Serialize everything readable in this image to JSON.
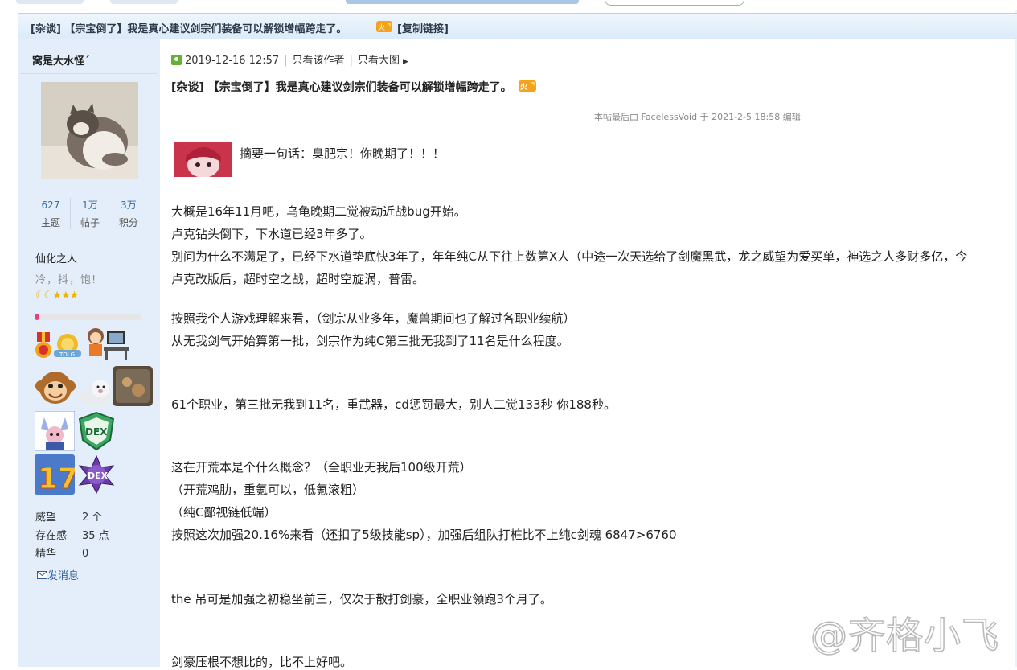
{
  "thread": {
    "title_bar": "[杂谈] 【宗宝倒了】我是真心建议剑宗们装备可以解锁增幅跨走了。",
    "copy_link": "[复制链接]"
  },
  "author": {
    "username": "窝是大水怪´",
    "stats": [
      {
        "num": "627",
        "label": "主题"
      },
      {
        "num": "1万",
        "label": "帖子"
      },
      {
        "num": "3万",
        "label": "积分"
      }
    ],
    "rank": "仙化之人",
    "motto": "冷，抖，饱!",
    "stars": "☾☾★★★",
    "progress_percent": 3,
    "info": [
      {
        "key": "威望",
        "value": "2 个"
      },
      {
        "key": "存在感",
        "value": "35 点"
      },
      {
        "key": "精华",
        "value": "0"
      }
    ],
    "send_message": "发消息"
  },
  "post": {
    "datetime": "2019-12-16 12:57",
    "only_author": "只看该作者",
    "only_big_image": "只看大图",
    "title": "[杂谈] 【宗宝倒了】我是真心建议剑宗们装备可以解锁增幅跨走了。",
    "edited_note": "本帖最后由 FacelessVoid 于 2021-2-5 18:58 编辑",
    "summary": "摘要一句话：臭肥宗！你晚期了！！！",
    "lines": [
      "大概是16年11月吧，乌龟晚期二觉被动近战bug开始。",
      "卢克钻头倒下，下水道已经3年多了。",
      "别问为什么不满足了，已经下水道垫底快3年了，年年纯C从下往上数第X人（中途一次天选给了剑魔黑武，龙之威望为爱买单，神选之人多财多亿，今",
      "卢克改版后，超时空之战，超时空旋涡，普雷。",
      "按照我个人游戏理解来看，（剑宗从业多年，魔兽期间也了解过各职业续航）",
      "从无我剑气开始算第一批，剑宗作为纯C第三批无我到了11名是什么程度。",
      "61个职业，第三批无我到11名，重武器，cd惩罚最大，别人二觉133秒 你188秒。",
      "这在开荒本是个什么概念？（全职业无我后100级开荒）",
      "（开荒鸡肋，重氪可以，低氪滚粗）",
      "（纯C鄙视链低端）",
      "按照这次加强20.16%来看（还扣了5级技能sp），加强后组队打桩比不上纯c剑魂 6847>6760",
      "the 吊可是加强之初稳坐前三，仅次于散打剑豪，全职业领跑3个月了。",
      "剑豪压根不想比的，比不上好吧。"
    ]
  },
  "watermark": "@齐格小飞"
}
